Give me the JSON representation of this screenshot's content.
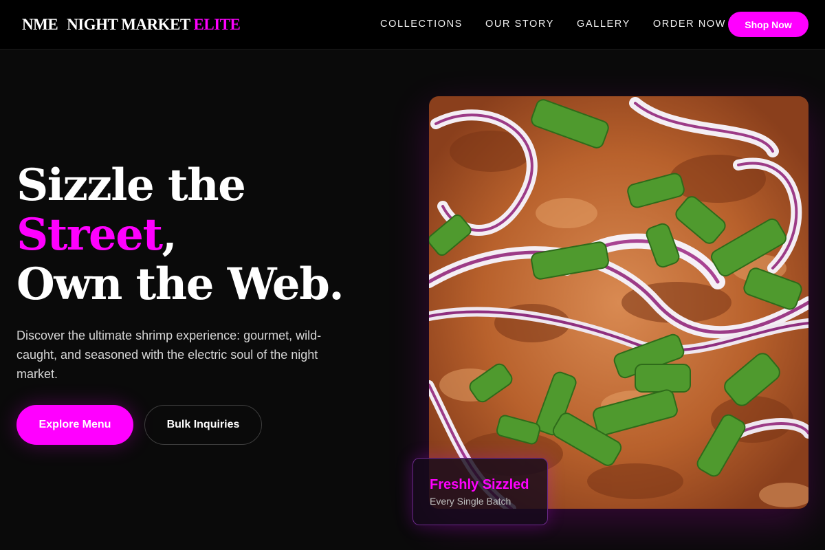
{
  "header": {
    "logo": {
      "mark": "NME",
      "word": "NIGHT MARKET",
      "accent": "ELITE"
    },
    "nav": [
      "COLLECTIONS",
      "OUR STORY",
      "GALLERY",
      "ORDER NOW"
    ],
    "cta": "Shop Now"
  },
  "hero": {
    "title": {
      "line1": "Sizzle the",
      "highlight": "Street",
      "comma": ",",
      "line3": "Own the Web."
    },
    "description": "Discover the ultimate shrimp experience: gourmet, wild-caught, and seasoned with the electric soul of the night market.",
    "primary_button": "Explore Menu",
    "secondary_button": "Bulk Inquiries"
  },
  "badge": {
    "title": "Freshly Sizzled",
    "subtitle": "Every Single Batch"
  },
  "colors": {
    "accent": "#ff00ff",
    "background": "#0a0a0a",
    "nav_background": "#000000"
  }
}
